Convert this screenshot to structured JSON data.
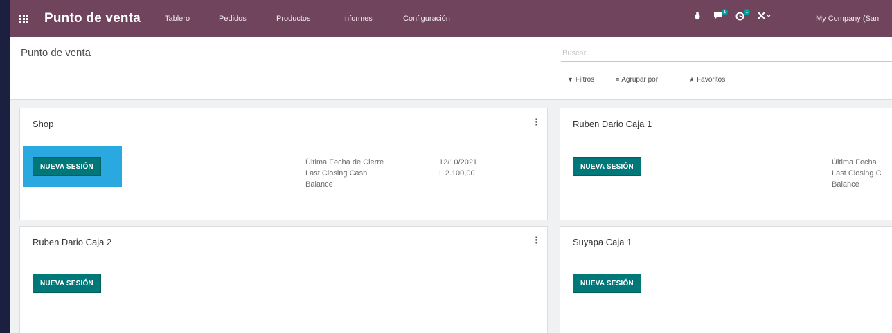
{
  "navbar": {
    "app_name": "Punto de venta",
    "menu": [
      "Tablero",
      "Pedidos",
      "Productos",
      "Informes",
      "Configuración"
    ],
    "chat_badge": "1",
    "activity_badge": "1",
    "company": "My Company (San"
  },
  "control_panel": {
    "title": "Punto de venta",
    "search_placeholder": "Buscar...",
    "filters_label": "Filtros",
    "group_by_label": "Agrupar por",
    "favorites_label": "Favoritos"
  },
  "cards": [
    {
      "name": "Shop",
      "button_label": "NUEVA SESIÓN",
      "stats": {
        "last_closing_date_label": "Última Fecha de Cierre",
        "last_closing_date": "12/10/2021",
        "last_closing_cash_label": "Last Closing Cash",
        "last_closing_cash": "L 2.100,00",
        "balance_label": "Balance"
      }
    },
    {
      "name": "Ruben Dario Caja 1",
      "button_label": "NUEVA SESIÓN",
      "stats": {
        "last_closing_date_label": "Última Fecha",
        "last_closing_cash_label": "Last Closing C",
        "balance_label": "Balance"
      }
    },
    {
      "name": "Ruben Dario Caja 2",
      "button_label": "NUEVA SESIÓN"
    },
    {
      "name": "Suyapa Caja 1",
      "button_label": "NUEVA SESIÓN"
    }
  ],
  "colors": {
    "navbar": "#71445d",
    "primary_button": "#00787a",
    "highlight": "#29a9e0",
    "badge": "#00a09d"
  }
}
